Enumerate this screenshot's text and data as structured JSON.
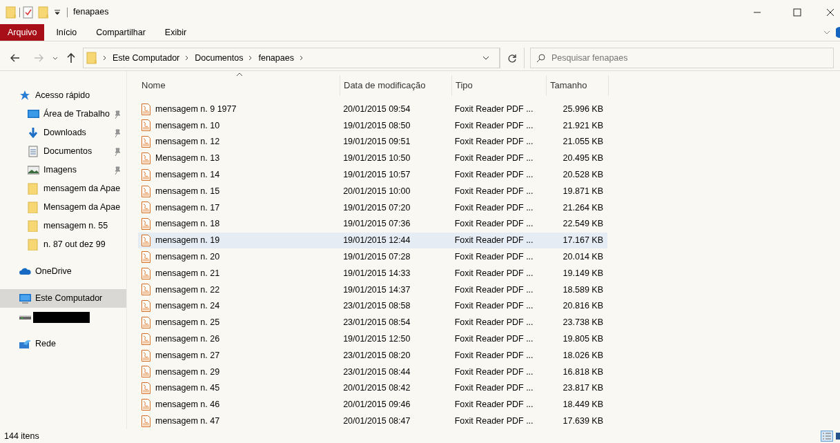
{
  "window": {
    "title": "fenapaes"
  },
  "ribbon_tabs": [
    {
      "label": "Arquivo",
      "selected": true
    },
    {
      "label": "Início",
      "selected": false
    },
    {
      "label": "Compartilhar",
      "selected": false
    },
    {
      "label": "Exibir",
      "selected": false
    }
  ],
  "address": {
    "crumbs": [
      "Este Computador",
      "Documentos",
      "fenapaes"
    ]
  },
  "search": {
    "placeholder": "Pesquisar fenapaes"
  },
  "sidebar": {
    "items": [
      {
        "kind": "star",
        "label": "Acesso rápido",
        "pinned": false,
        "selected": false
      },
      {
        "kind": "desktop",
        "label": "Área de Trabalho",
        "pinned": true,
        "selected": false
      },
      {
        "kind": "download",
        "label": "Downloads",
        "pinned": true,
        "selected": false
      },
      {
        "kind": "document",
        "label": "Documentos",
        "pinned": true,
        "selected": false
      },
      {
        "kind": "image",
        "label": "Imagens",
        "pinned": true,
        "selected": false
      },
      {
        "kind": "folder",
        "label": "mensagem da Apae",
        "pinned": false,
        "selected": false
      },
      {
        "kind": "folder",
        "label": "Mensagem da Apae",
        "pinned": false,
        "selected": false
      },
      {
        "kind": "folder",
        "label": "mensagem n. 55",
        "pinned": false,
        "selected": false
      },
      {
        "kind": "folder",
        "label": "n. 87 out dez 99",
        "pinned": false,
        "selected": false
      },
      {
        "kind": "cloud",
        "label": "OneDrive",
        "pinned": false,
        "selected": false
      },
      {
        "kind": "computer",
        "label": "Este Computador",
        "pinned": false,
        "selected": true
      },
      {
        "kind": "drive",
        "pinned": false,
        "selected": false
      },
      {
        "kind": "network",
        "label": "Rede",
        "pinned": false,
        "selected": false
      }
    ]
  },
  "table": {
    "columns": [
      "Nome",
      "Data de modificação",
      "Tipo",
      "Tamanho"
    ],
    "rows": [
      {
        "name": "mensagem n. 9  1977",
        "date": "20/01/2015 09:54",
        "type": "Foxit Reader PDF ...",
        "size": "25.996 KB",
        "selected": false
      },
      {
        "name": "mensagem n. 10",
        "date": "19/01/2015 08:50",
        "type": "Foxit Reader PDF ...",
        "size": "21.921 KB",
        "selected": false
      },
      {
        "name": "mensagem n. 12",
        "date": "19/01/2015 09:51",
        "type": "Foxit Reader PDF ...",
        "size": "21.055 KB",
        "selected": false
      },
      {
        "name": "Mensagem n. 13",
        "date": "19/01/2015 10:50",
        "type": "Foxit Reader PDF ...",
        "size": "20.495 KB",
        "selected": false
      },
      {
        "name": "mensagem n. 14",
        "date": "19/01/2015 10:57",
        "type": "Foxit Reader PDF ...",
        "size": "20.528 KB",
        "selected": false
      },
      {
        "name": "mensagem n. 15",
        "date": "20/01/2015 10:00",
        "type": "Foxit Reader PDF ...",
        "size": "19.871 KB",
        "selected": false
      },
      {
        "name": "mensagem n. 17",
        "date": "19/01/2015 07:20",
        "type": "Foxit Reader PDF ...",
        "size": "21.264 KB",
        "selected": false
      },
      {
        "name": "mensagem n. 18",
        "date": "19/01/2015 07:36",
        "type": "Foxit Reader PDF ...",
        "size": "22.549 KB",
        "selected": false
      },
      {
        "name": "mensagem n. 19",
        "date": "19/01/2015 12:44",
        "type": "Foxit Reader PDF ...",
        "size": "17.167 KB",
        "selected": true
      },
      {
        "name": "mensagem n. 20",
        "date": "19/01/2015 07:28",
        "type": "Foxit Reader PDF ...",
        "size": "20.014 KB",
        "selected": false
      },
      {
        "name": "mensagem n. 21",
        "date": "19/01/2015 14:33",
        "type": "Foxit Reader PDF ...",
        "size": "19.149 KB",
        "selected": false
      },
      {
        "name": "mensagem n. 22",
        "date": "19/01/2015 14:37",
        "type": "Foxit Reader PDF ...",
        "size": "18.589 KB",
        "selected": false
      },
      {
        "name": "mensagem n. 24",
        "date": "23/01/2015 08:58",
        "type": "Foxit Reader PDF ...",
        "size": "20.816 KB",
        "selected": false
      },
      {
        "name": "mensagem n. 25",
        "date": "23/01/2015 08:54",
        "type": "Foxit Reader PDF ...",
        "size": "23.738 KB",
        "selected": false
      },
      {
        "name": "mensagem n. 26",
        "date": "19/01/2015 12:50",
        "type": "Foxit Reader PDF ...",
        "size": "19.805 KB",
        "selected": false
      },
      {
        "name": "mensagem n. 27",
        "date": "23/01/2015 08:20",
        "type": "Foxit Reader PDF ...",
        "size": "18.026 KB",
        "selected": false
      },
      {
        "name": "mensagem n. 29",
        "date": "23/01/2015 08:44",
        "type": "Foxit Reader PDF ...",
        "size": "16.818 KB",
        "selected": false
      },
      {
        "name": "mensagem n. 45",
        "date": "20/01/2015 08:42",
        "type": "Foxit Reader PDF ...",
        "size": "23.817 KB",
        "selected": false
      },
      {
        "name": "mensagem n. 46",
        "date": "20/01/2015 09:46",
        "type": "Foxit Reader PDF ...",
        "size": "18.449 KB",
        "selected": false
      },
      {
        "name": "mensagem n. 47",
        "date": "20/01/2015 08:47",
        "type": "Foxit Reader PDF ...",
        "size": "17.639 KB",
        "selected": false
      }
    ]
  },
  "status_bar": {
    "count": "144 itens"
  }
}
